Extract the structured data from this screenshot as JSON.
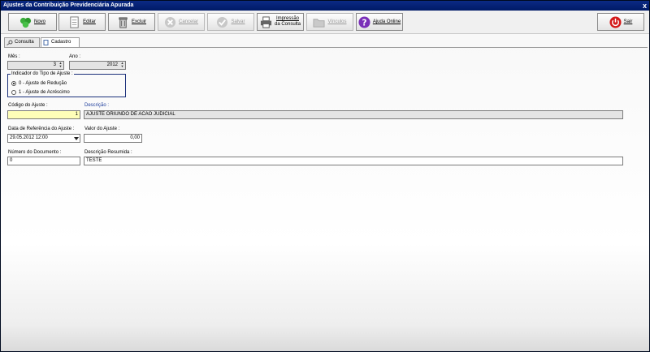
{
  "window": {
    "title": "Ajustes da Contribuição Previdenciária Apurada",
    "close_label": "x"
  },
  "toolbar": {
    "novo": "Novo",
    "editar": "Editar",
    "excluir": "Excluir",
    "cancelar": "Cancelar",
    "salvar": "Salvar",
    "impressao_line1": "Impressão",
    "impressao_line2": "da Consulta",
    "vinculos": "Vínculos",
    "ajuda": "Ajuda Online",
    "sair": "Sair"
  },
  "tabs": {
    "consulta": "Consulta",
    "cadastro": "Cadastro"
  },
  "form": {
    "mes_label": "Mês :",
    "mes_value": "3",
    "ano_label": "Ano :",
    "ano_value": "2012",
    "group_label": "Indicador do Tipo de Ajuste :",
    "radio_0": "0 - Ajuste de Redução",
    "radio_1": "1 - Ajuste de Acréscimo",
    "codigo_label": "Código do Ajuste :",
    "codigo_value": "1",
    "descricao_label": "Descrição :",
    "descricao_value": "AJUSTE ORIUNDO DE ACAO JUDICIAL",
    "data_label": "Data de Referência do Ajuste :",
    "data_value": "29.05.2012 12:00",
    "valor_label": "Valor do Ajuste :",
    "valor_value": "0,00",
    "numero_label": "Número do Documento :",
    "numero_value": "0",
    "desc_resumida_label": "Descrição Resumida :",
    "desc_resumida_value": "TESTE"
  },
  "icons": {
    "novo": "green-puzzle-icon",
    "editar": "document-edit-icon",
    "excluir": "trash-bin-icon",
    "cancelar": "cancel-circle-icon",
    "salvar": "check-circle-icon",
    "impressao": "printer-icon",
    "vinculos": "folder-link-icon",
    "ajuda": "help-question-icon",
    "sair": "exit-power-icon"
  }
}
